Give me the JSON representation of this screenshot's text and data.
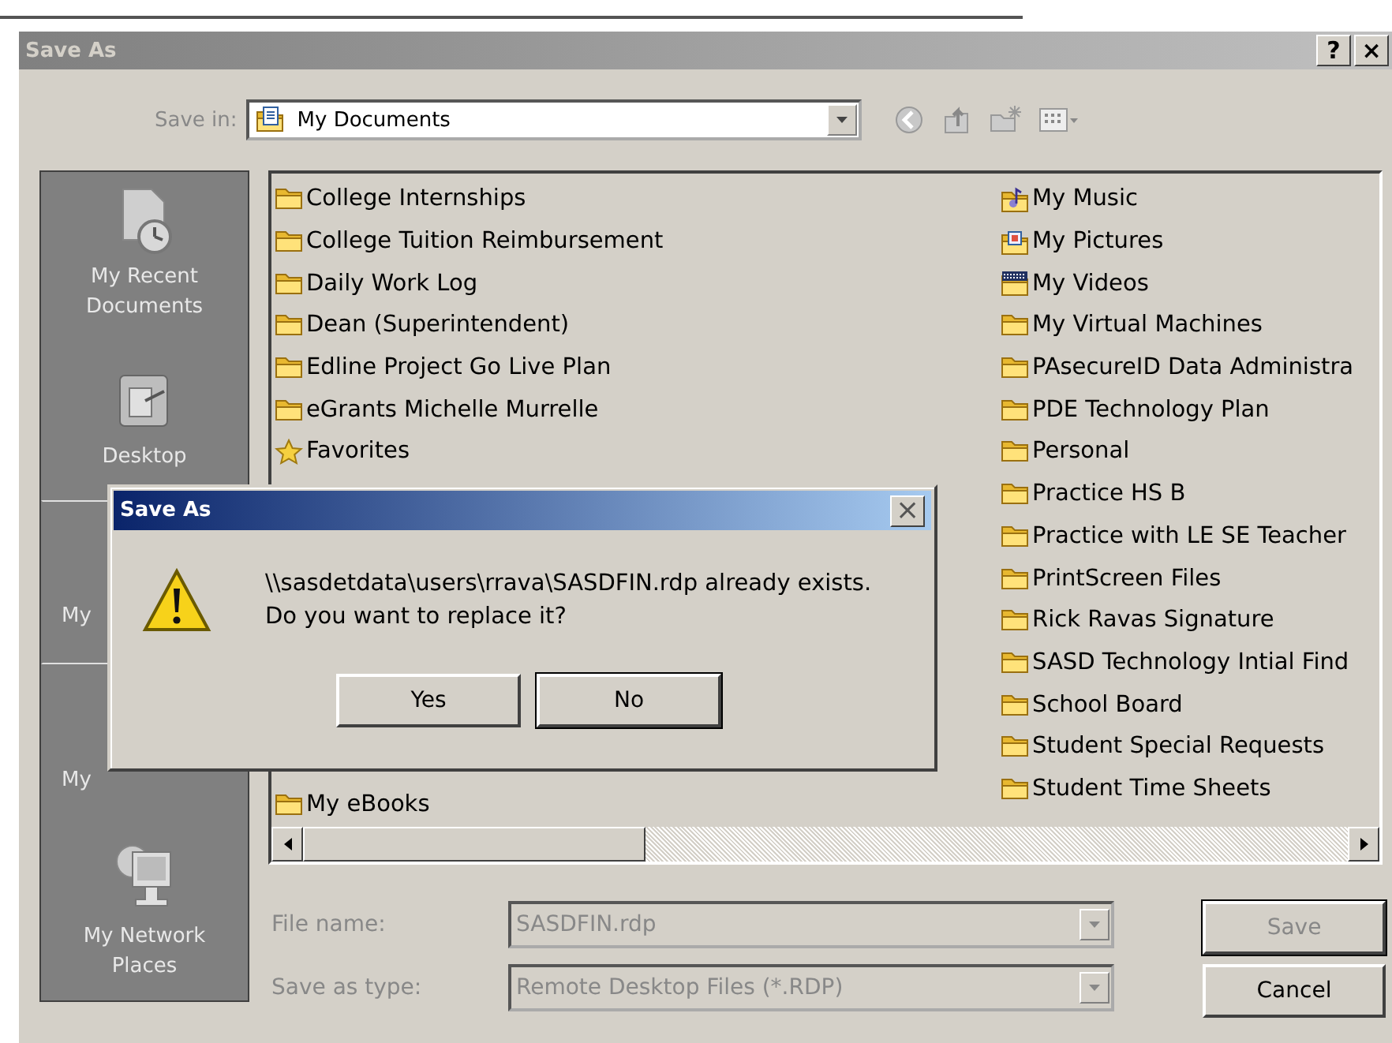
{
  "window": {
    "title": "Save As",
    "help_label": "?",
    "close_label": "×",
    "active": false
  },
  "save_in": {
    "label": "Save in:",
    "value": "My Documents"
  },
  "places": [
    {
      "label": "My Recent Documents",
      "kind": "recent",
      "selected": false
    },
    {
      "label": "Desktop",
      "kind": "desktop",
      "selected": false
    },
    {
      "label": "My",
      "kind": "covered",
      "selected": true
    },
    {
      "label": "My",
      "kind": "covered",
      "selected": false
    },
    {
      "label": "My Network Places",
      "kind": "network",
      "selected": false
    }
  ],
  "files": {
    "column_1": [
      {
        "name": "College Internships",
        "kind": "folder"
      },
      {
        "name": "College Tuition Reimbursement",
        "kind": "folder"
      },
      {
        "name": "Daily Work Log",
        "kind": "folder"
      },
      {
        "name": "Dean (Superintendent)",
        "kind": "folder"
      },
      {
        "name": "Edline Project Go Live Plan",
        "kind": "folder"
      },
      {
        "name": "eGrants Michelle Murrelle",
        "kind": "folder"
      },
      {
        "name": "Favorites",
        "kind": "star"
      }
    ],
    "column_1_lower": [
      {
        "name": "My eBooks",
        "kind": "folder"
      }
    ],
    "column_2": [
      {
        "name": "My Music",
        "kind": "music"
      },
      {
        "name": "My Pictures",
        "kind": "pictures"
      },
      {
        "name": "My Videos",
        "kind": "videos"
      },
      {
        "name": "My Virtual Machines",
        "kind": "folder"
      },
      {
        "name": "PAsecureID Data Administra",
        "kind": "folder"
      },
      {
        "name": "PDE Technology Plan",
        "kind": "folder"
      },
      {
        "name": "Personal",
        "kind": "folder"
      },
      {
        "name": "Practice HS B",
        "kind": "folder"
      },
      {
        "name": "Practice with LE SE Teacher",
        "kind": "folder"
      },
      {
        "name": "PrintScreen Files",
        "kind": "folder"
      },
      {
        "name": "Rick Ravas Signature",
        "kind": "folder"
      },
      {
        "name": "SASD Technology Intial Find",
        "kind": "folder"
      },
      {
        "name": "School Board",
        "kind": "folder"
      },
      {
        "name": "Student Special Requests",
        "kind": "folder"
      },
      {
        "name": "Student Time Sheets",
        "kind": "folder"
      }
    ]
  },
  "file_name": {
    "label": "File name:",
    "value": "SASDFIN.rdp",
    "disabled": true
  },
  "save_as_type": {
    "label": "Save as type:",
    "value": "Remote Desktop Files (*.RDP)",
    "disabled": true
  },
  "buttons": [
    {
      "label": "Save",
      "disabled": true
    },
    {
      "label": "Cancel",
      "disabled": false
    }
  ],
  "confirm": {
    "title": "Save As",
    "close_label": "×",
    "message_lines": [
      "\\\\sasdetdata\\users\\rrava\\SASDFIN.rdp already exists.",
      "Do you want to replace it?"
    ],
    "buttons": [
      {
        "label": "Yes",
        "default": false
      },
      {
        "label": "No",
        "default": true
      }
    ]
  }
}
